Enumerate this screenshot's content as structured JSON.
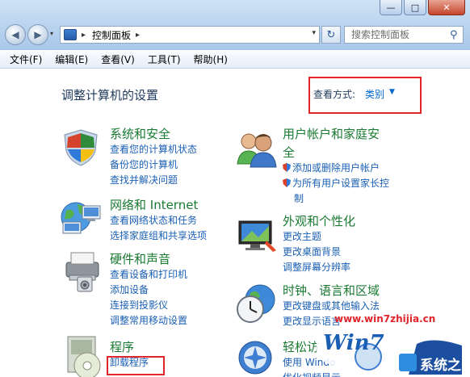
{
  "window": {
    "min_label": "—",
    "max_label": "□",
    "close_label": "✕"
  },
  "nav": {
    "back_icon": "◀",
    "forward_icon": "▶",
    "dropdown_icon": "▾"
  },
  "address": {
    "breadcrumb": "控制面板",
    "sep": "▸",
    "dropdown": "▾",
    "refresh_icon": "↻"
  },
  "search": {
    "placeholder": "搜索控制面板",
    "icon": "⚲"
  },
  "menu": [
    "文件(F)",
    "编辑(E)",
    "查看(V)",
    "工具(T)",
    "帮助(H)"
  ],
  "header": {
    "title": "调整计算机的设置",
    "view_by_label": "查看方式:",
    "view_by_value": "类别",
    "caret": "▼"
  },
  "categories": [
    {
      "title": "系统和安全",
      "links": [
        "查看您的计算机状态",
        "备份您的计算机",
        "查找并解决问题"
      ]
    },
    {
      "title": "网络和 Internet",
      "links": [
        "查看网络状态和任务",
        "选择家庭组和共享选项"
      ]
    },
    {
      "title": "硬件和声音",
      "links": [
        "查看设备和打印机",
        "添加设备",
        "连接到投影仪",
        "调整常用移动设置"
      ]
    },
    {
      "title": "程序",
      "links": [
        "卸载程序"
      ]
    },
    {
      "title_line1": "用户帐户和家庭安",
      "title_line2": "全",
      "links": [
        "添加或删除用户帐户",
        "为所有用户设置家长控",
        "制"
      ]
    },
    {
      "title": "外观和个性化",
      "links": [
        "更改主题",
        "更改桌面背景",
        "调整屏幕分辨率"
      ]
    },
    {
      "title": "时钟、语言和区域",
      "links": [
        "更改键盘或其他输入法",
        "更改显示语言"
      ]
    },
    {
      "title": "轻松访",
      "links": [
        "使用 Windo",
        "优化视频显示"
      ]
    }
  ],
  "watermark": {
    "url": "www.win7zhijia.cn",
    "brand": "系统之家",
    "logo_text": "Win7"
  },
  "colors": {
    "link": "#1a5fb4",
    "category_title": "#1a7a32",
    "highlight_box": "#e0242c",
    "heading": "#1e395b"
  }
}
